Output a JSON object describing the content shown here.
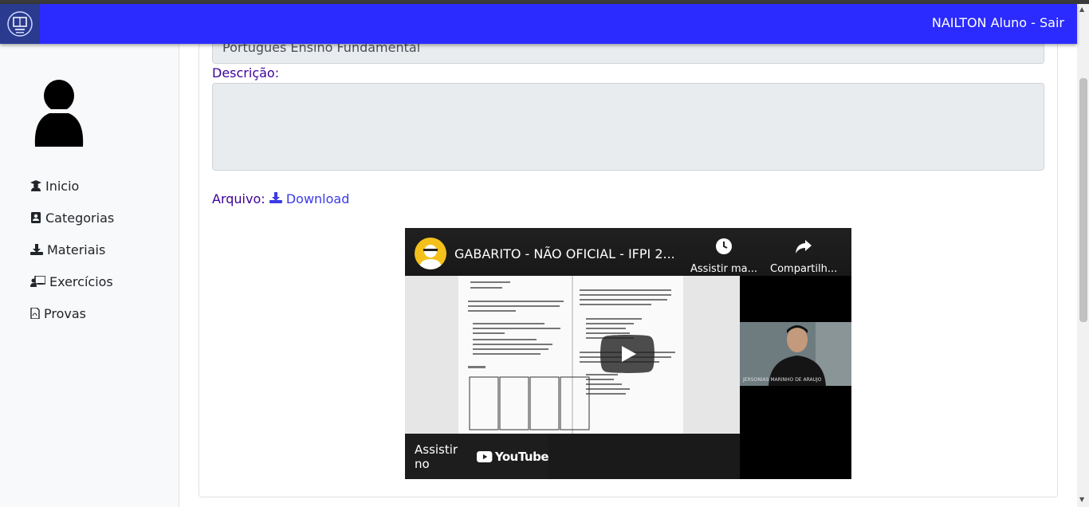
{
  "navbar": {
    "user_label": "NAILTON Aluno - Sair"
  },
  "sidebar": {
    "items": [
      {
        "label": "Inicio",
        "icon": "user-graduate-icon"
      },
      {
        "label": "Categorias",
        "icon": "address-book-icon"
      },
      {
        "label": "Materiais",
        "icon": "download-icon"
      },
      {
        "label": "Exercícios",
        "icon": "chalkboard-teacher-icon"
      },
      {
        "label": "Provas",
        "icon": "file-pdf-icon"
      }
    ]
  },
  "form": {
    "title_value": "Português Ensino Fundamental",
    "description_label": "Descrição:",
    "description_value": "",
    "file_label": "Arquivo:",
    "download_label": "Download"
  },
  "video": {
    "title": "GABARITO - NÃO OFICIAL - IFPI 2...",
    "watch_later": "Assistir ma...",
    "share": "Compartilh...",
    "watch_on": "Assistir no",
    "youtube": "YouTube",
    "webcam_caption": "JERSONIAS MARINHO DE ARAUJO"
  },
  "colors": {
    "navbar": "#2b2bff",
    "label": "#3d0099",
    "link": "#3b3be8"
  }
}
